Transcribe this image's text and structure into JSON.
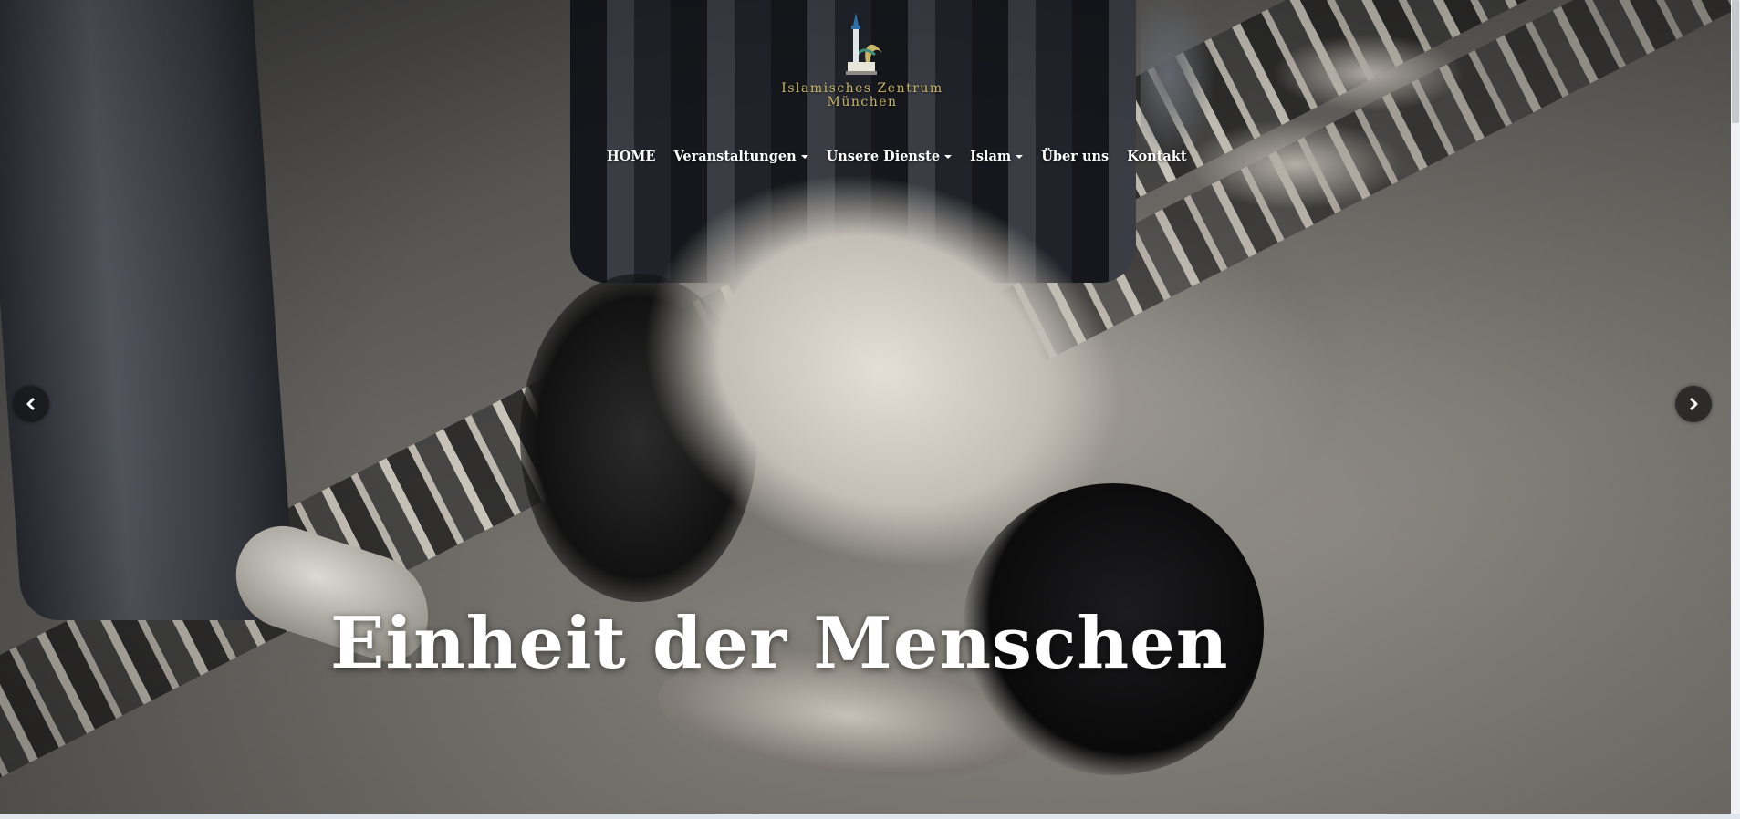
{
  "site": {
    "logo_line1": "Islamisches Zentrum",
    "logo_line2": "München",
    "logo_icon": "mosque-minaret-logo",
    "accent_color": "#c9b56a"
  },
  "nav": {
    "items": [
      {
        "label": "HOME",
        "has_dropdown": false
      },
      {
        "label": "Veranstaltungen",
        "has_dropdown": true
      },
      {
        "label": "Unsere Dienste",
        "has_dropdown": true
      },
      {
        "label": "Islam",
        "has_dropdown": true
      },
      {
        "label": "Über uns",
        "has_dropdown": false
      },
      {
        "label": "Kontakt",
        "has_dropdown": false
      }
    ]
  },
  "hero": {
    "headline": "Einheit der Menschen",
    "prev_icon": "chevron-left-icon",
    "next_icon": "chevron-right-icon"
  }
}
